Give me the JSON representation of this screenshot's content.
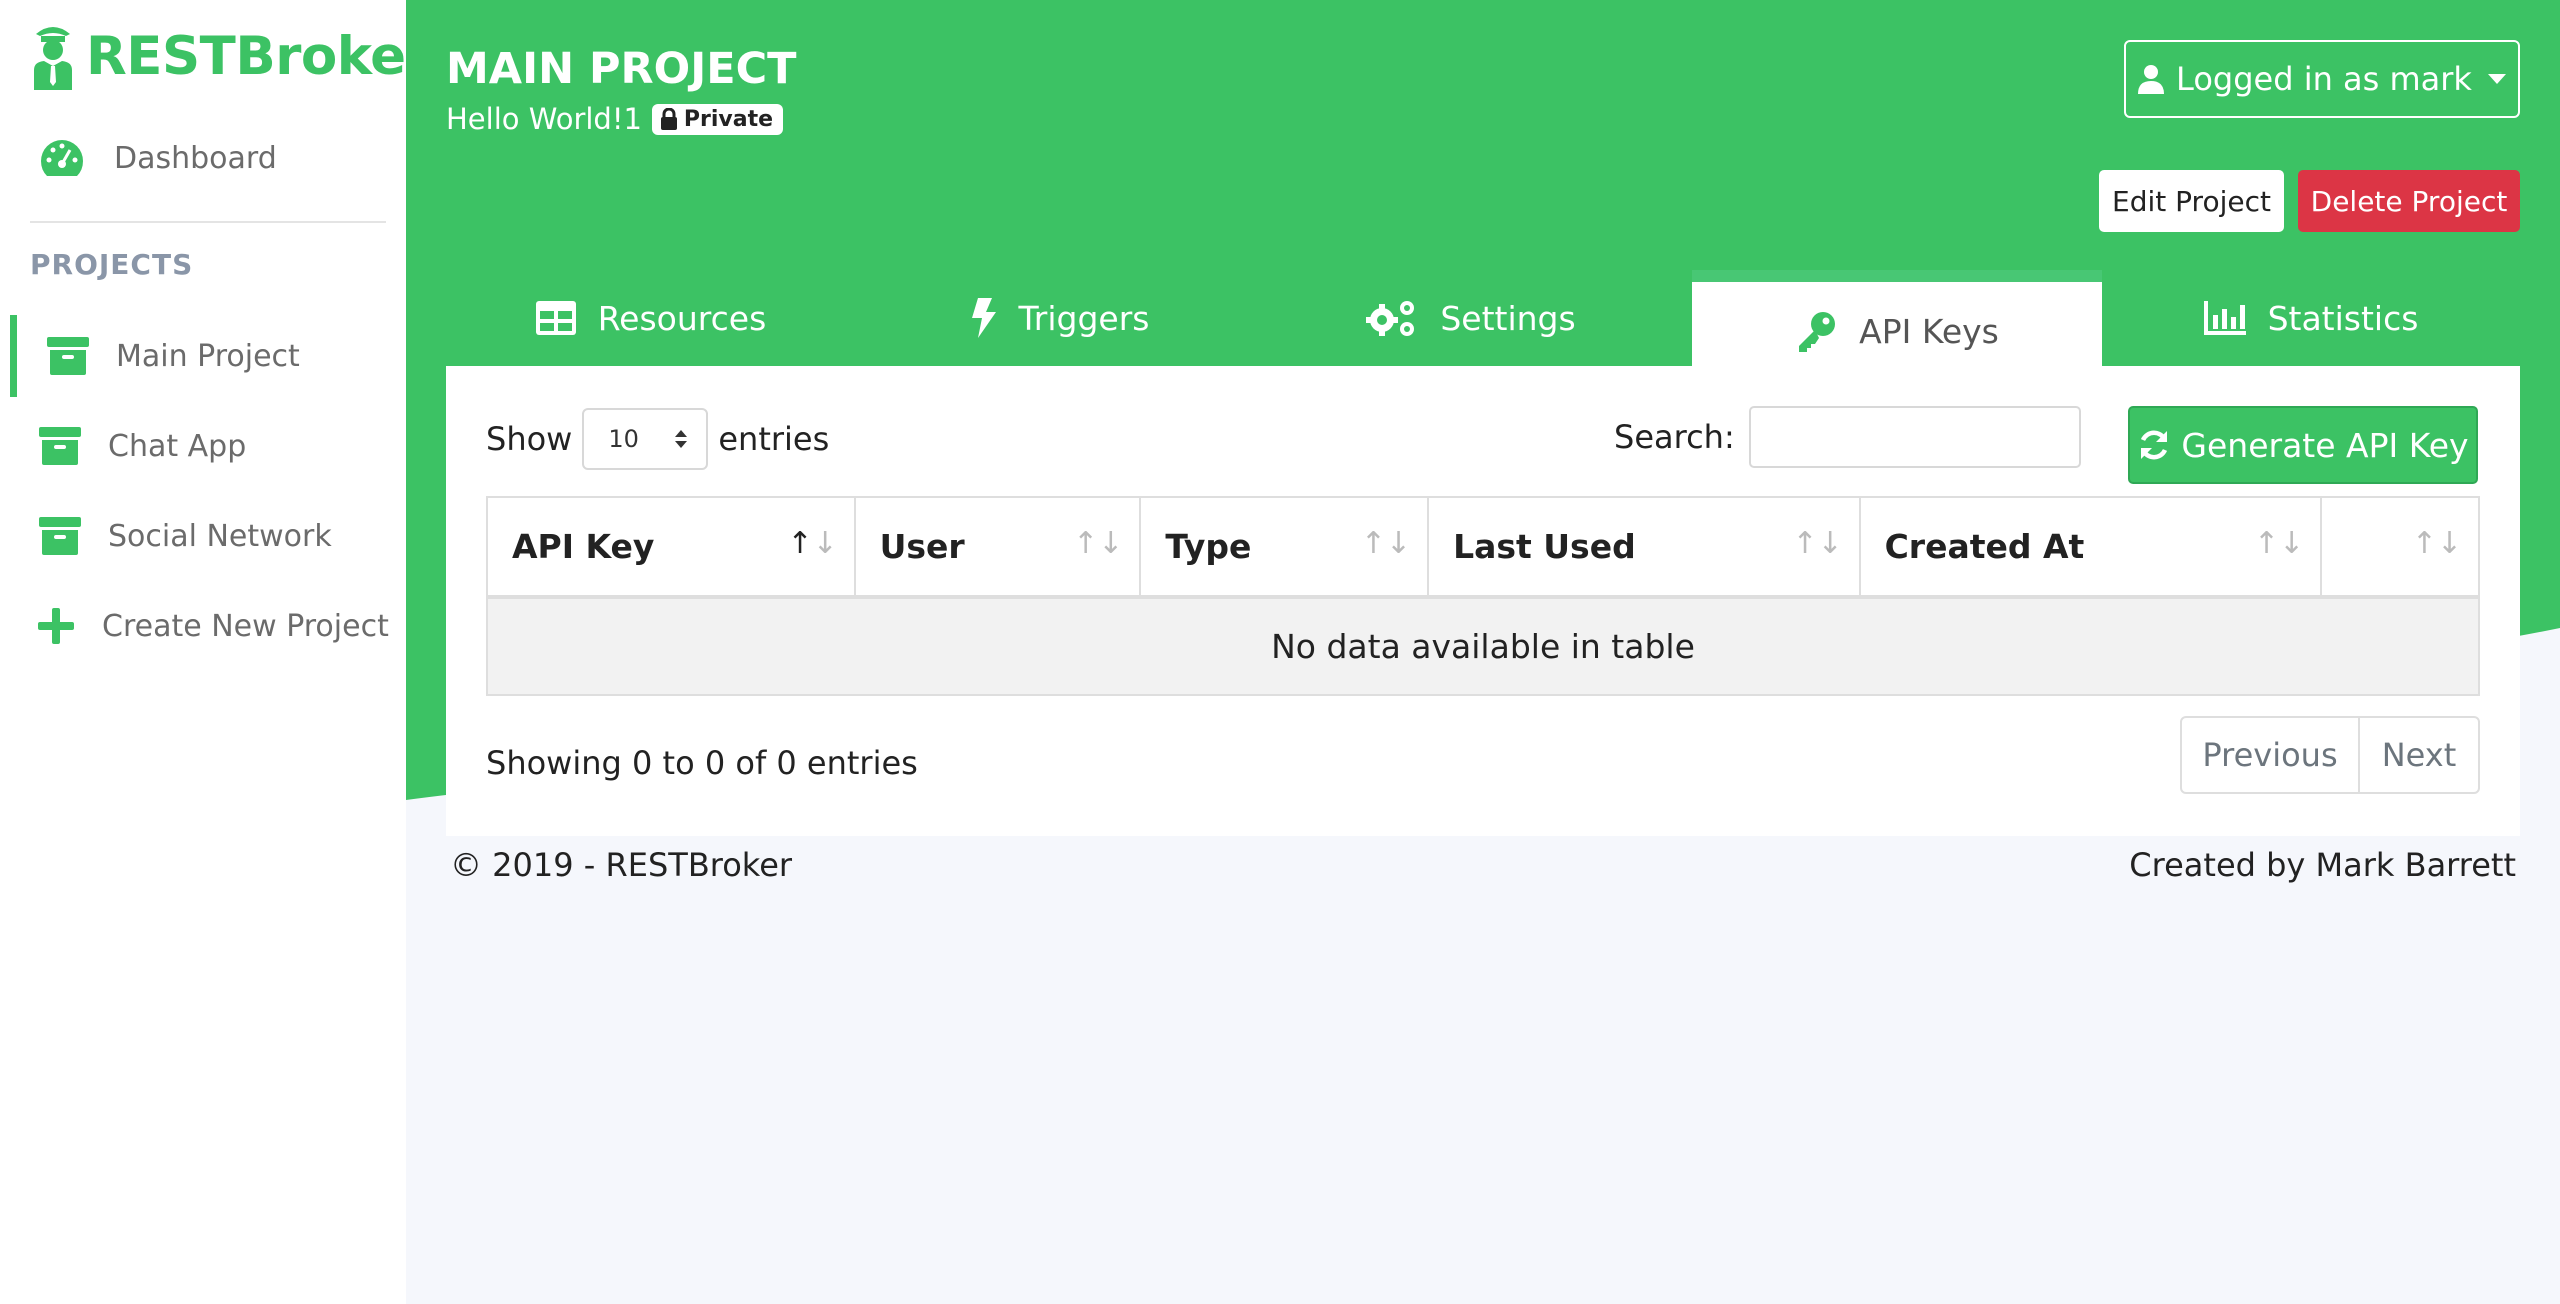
{
  "brand": {
    "name": "RESTBroker",
    "color": "#3cc264"
  },
  "sidebar": {
    "dashboard_label": "Dashboard",
    "section_heading": "PROJECTS",
    "projects": [
      {
        "label": "Main Project",
        "active": true
      },
      {
        "label": "Chat App",
        "active": false
      },
      {
        "label": "Social Network",
        "active": false
      }
    ],
    "create_label": "Create New Project"
  },
  "header": {
    "project_title": "MAIN PROJECT",
    "description": "Hello World!1",
    "privacy_badge": "Private",
    "user_menu": "Logged in as mark",
    "edit_button": "Edit Project",
    "delete_button": "Delete Project"
  },
  "tabs": [
    {
      "label": "Resources",
      "icon": "table-icon"
    },
    {
      "label": "Triggers",
      "icon": "bolt-icon"
    },
    {
      "label": "Settings",
      "icon": "cogs-icon"
    },
    {
      "label": "API Keys",
      "icon": "key-icon",
      "active": true
    },
    {
      "label": "Statistics",
      "icon": "bar-chart-icon"
    }
  ],
  "table_controls": {
    "show_label": "Show",
    "entries_value": "10",
    "entries_label": "entries",
    "search_label": "Search:",
    "search_value": "",
    "generate_button": "Generate API Key"
  },
  "table": {
    "columns": [
      "API Key",
      "User",
      "Type",
      "Last Used",
      "Created At",
      ""
    ],
    "empty_message": "No data available in table",
    "info": "Showing 0 to 0 of 0 entries",
    "prev_label": "Previous",
    "next_label": "Next"
  },
  "footer": {
    "copyright": "© 2019 - RESTBroker",
    "credit": "Created by Mark Barrett"
  },
  "colors": {
    "accent_green": "#3cc264",
    "danger_red": "#dc3545",
    "page_bg": "#f5f7fc"
  }
}
